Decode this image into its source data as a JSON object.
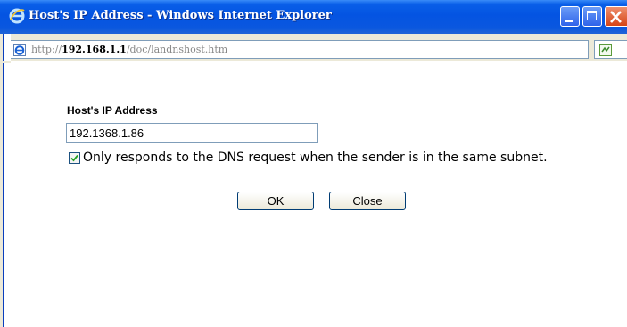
{
  "window": {
    "title": "Host's IP Address - Windows Internet Explorer"
  },
  "addressbar": {
    "url_prefix": "http://",
    "url_host": "192.168.1.1",
    "url_path": "/doc/landnshost.htm"
  },
  "form": {
    "label": "Host's IP Address",
    "ip_value": "192.1368.1.86",
    "checkbox_checked": true,
    "checkbox_label": "Only responds to the DNS request when the sender is in the same subnet.",
    "ok_label": "OK",
    "close_label": "Close"
  },
  "colors": {
    "titlebar": "#0454e2",
    "close_button": "#d54416",
    "frame": "#ece9d8"
  },
  "icons": {
    "title": "ie-logo-icon",
    "address": "ie-page-icon",
    "side": "compatibility-icon"
  }
}
